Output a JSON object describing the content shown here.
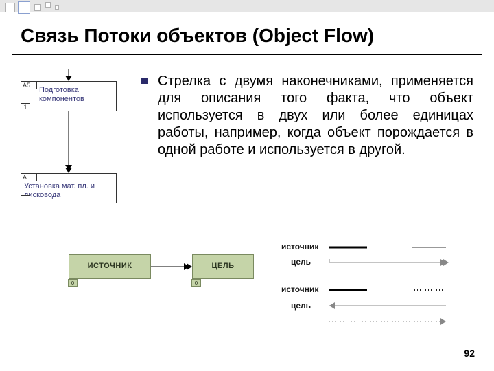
{
  "title": "Связь Потоки объектов (Object Flow)",
  "body": "Стрелка с двумя наконечниками, применяется для описания того факта, что объект используется в двух или более единицах работы, например, когда объект порождается в одной работе и используется в другой.",
  "left_diagram": {
    "box1": {
      "id_tl": "A5",
      "id_bl": "1",
      "label": "Подготовка компонентов"
    },
    "box2": {
      "id_tl": "A",
      "id_bl": "",
      "label": "Установка мат. пл. и дисковода"
    }
  },
  "bottom_diagram": {
    "source_label": "ИСТОЧНИК",
    "target_label": "ЦЕЛЬ",
    "source_bl": "0",
    "target_bl": "0"
  },
  "legend": {
    "row1_left": "источник",
    "row1_right": "цель",
    "row2_left": "источник",
    "row2_right": "цель"
  },
  "page": "92"
}
